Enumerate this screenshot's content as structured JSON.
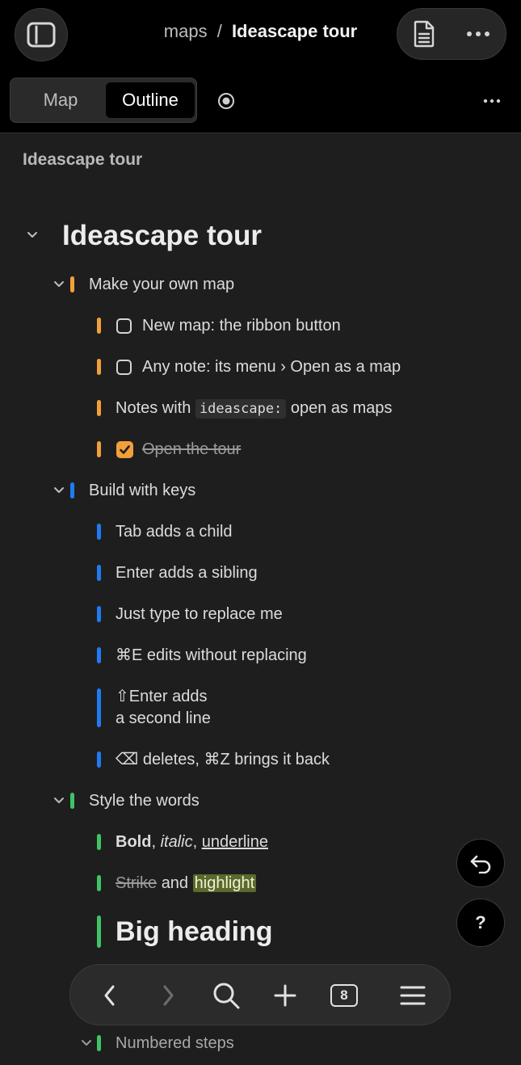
{
  "header": {
    "breadcrumb_parent": "maps",
    "breadcrumb_sep": "/",
    "breadcrumb_current": "Ideascape tour",
    "icons": [
      "sidebar-icon",
      "file-icon",
      "more-icon"
    ]
  },
  "view_switcher": {
    "options": [
      "Map",
      "Outline"
    ],
    "selected": "Outline"
  },
  "view_title": "Ideascape tour",
  "outline": {
    "root": "Ideascape tour",
    "make_map": {
      "label": "Make your own map",
      "items": [
        "New map: the ribbon button",
        "Any note: its menu › Open as a map",
        {
          "before": "Notes with",
          "code": "ideascape:",
          "after": "open as maps"
        },
        "Open the tour"
      ],
      "checked": [
        false,
        false,
        null,
        true
      ]
    },
    "build_keys": {
      "label": "Build with keys",
      "items": [
        "Tab adds a child",
        "Enter adds a sibling",
        "Just type to replace me",
        "⌘E edits without replacing",
        "⇧Enter adds",
        "a second line",
        "⌫ deletes, ⌘Z brings it back"
      ]
    },
    "style_words": {
      "label": "Style the words",
      "bold": "Bold",
      "sep1": ",",
      "italic": "italic",
      "sep2": ",",
      "underline": "underline",
      "strike": "Strike",
      "and": "and",
      "highlight": "highlight",
      "heading": "Big heading"
    },
    "numbered": "Numbered steps"
  },
  "colors": {
    "orange": "#f2a03a",
    "blue": "#1f7bf2",
    "green": "#3fc465"
  },
  "bottom_toolbar": {
    "icons": [
      "back-icon",
      "forward-icon",
      "search-icon",
      "plus-icon",
      "tabs-icon",
      "menu-icon"
    ],
    "tab_count": "8"
  }
}
